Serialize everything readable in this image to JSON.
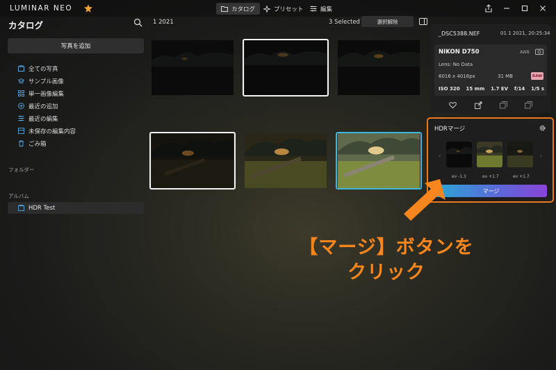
{
  "app": {
    "logo": "LUMINAR NEO",
    "tabs": [
      {
        "label": "カタログ",
        "icon": "folder-icon"
      },
      {
        "label": "プリセット",
        "icon": "sparkle-icon"
      },
      {
        "label": "編集",
        "icon": "sliders-icon"
      }
    ]
  },
  "sidebar": {
    "title": "カタログ",
    "add_photo": "写真を追加",
    "items": [
      {
        "label": "全ての写真",
        "icon": "photos-icon"
      },
      {
        "label": "サンプル画像",
        "icon": "graduation-cap-icon"
      },
      {
        "label": "単一画像編集",
        "icon": "grid-icon"
      },
      {
        "label": "最近の追加",
        "icon": "plus-circle-icon"
      },
      {
        "label": "最近の編集",
        "icon": "sliders-icon"
      },
      {
        "label": "未保存の編集内容",
        "icon": "unsaved-icon"
      },
      {
        "label": "ごみ箱",
        "icon": "trash-icon"
      }
    ],
    "folders_label": "フォルダー",
    "albums_label": "アルバム",
    "album": {
      "label": "HDR Test",
      "icon": "album-icon"
    }
  },
  "grid": {
    "date_group": "1 2021",
    "selected_count": "3 Selected",
    "deselect": "選択解除"
  },
  "info": {
    "filename": "_DSC5388.NEF",
    "date": "01 1 2021, 20:25:34",
    "camera": "NIKON D750",
    "wb": "AWB",
    "lens": "Lens: No Data",
    "dimensions": "6016 x 4016px",
    "filesize": "31 MB",
    "badge": "RAW",
    "exif": [
      "ISO 320",
      "15 mm",
      "1.7 EV",
      "f/14",
      "1/5 s"
    ]
  },
  "hdr": {
    "title": "HDRマージ",
    "evs": [
      "ev -1.3",
      "ev +1.7",
      "ev +1.7"
    ],
    "merge": "マージ"
  },
  "annotation": {
    "line1": "【マージ】ボタンを",
    "line2": "クリック",
    "color": "#f7861f"
  },
  "colors": {
    "accent_blue": "#3db7df",
    "highlight_orange": "#f07a1a"
  }
}
